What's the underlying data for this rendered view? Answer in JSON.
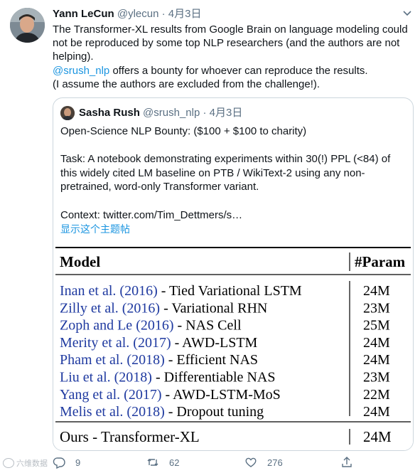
{
  "tweet": {
    "author_name": "Yann LeCun",
    "author_handle": "@ylecun",
    "separator": "·",
    "date": "4月3日",
    "text_part1": "The Transformer-XL results from Google Brain on language modeling could not be reproduced by some top NLP researchers (and the authors are not helping).\n",
    "mention": "@srush_nlp",
    "text_part2": " offers a bounty for whoever can reproduce the results.\n(I assume the authors are excluded from the challenge!)."
  },
  "quote": {
    "author_name": "Sasha Rush",
    "author_handle": "@srush_nlp",
    "separator": "·",
    "date": "4月3日",
    "text": "Open-Science NLP Bounty: ($100 + $100 to charity)\n\nTask: A notebook demonstrating experiments within  30(!) PPL (<84) of this widely cited LM baseline on PTB / WikiText-2 using any non-pretrained, word-only Transformer variant.\n\nContext: twitter.com/Tim_Dettmers/s…",
    "show_thread": "显示这个主题帖"
  },
  "table": {
    "header": {
      "model": "Model",
      "param": "#Param"
    },
    "rows": [
      {
        "cite": "Inan et al. (2016)",
        "desc": " - Tied Variational LSTM",
        "param": "24M"
      },
      {
        "cite": "Zilly et al. (2016)",
        "desc": " - Variational RHN",
        "param": "23M"
      },
      {
        "cite": "Zoph and Le (2016)",
        "desc": " - NAS Cell",
        "param": "25M"
      },
      {
        "cite": "Merity et al. (2017)",
        "desc": " - AWD-LSTM",
        "param": "24M"
      },
      {
        "cite": "Pham et al. (2018)",
        "desc": " - Efficient NAS",
        "param": "24M"
      },
      {
        "cite": "Liu et al. (2018)",
        "desc": " - Differentiable NAS",
        "param": "23M"
      },
      {
        "cite": "Yang et al. (2017)",
        "desc": " - AWD-LSTM-MoS",
        "param": "22M"
      },
      {
        "cite": "Melis et al. (2018)",
        "desc": " - Dropout tuning",
        "param": "24M"
      }
    ],
    "ours": {
      "model": "Ours - Transformer-XL",
      "param": "24M"
    },
    "cite_color": "#1f3aa0"
  },
  "actions": {
    "reply_count": "9",
    "retweet_count": "62",
    "like_count": "276"
  },
  "icons": {
    "caret": "chevron-down-icon",
    "reply": "reply-icon",
    "retweet": "retweet-icon",
    "like": "heart-icon",
    "share": "share-icon"
  },
  "watermark": "六维数据"
}
